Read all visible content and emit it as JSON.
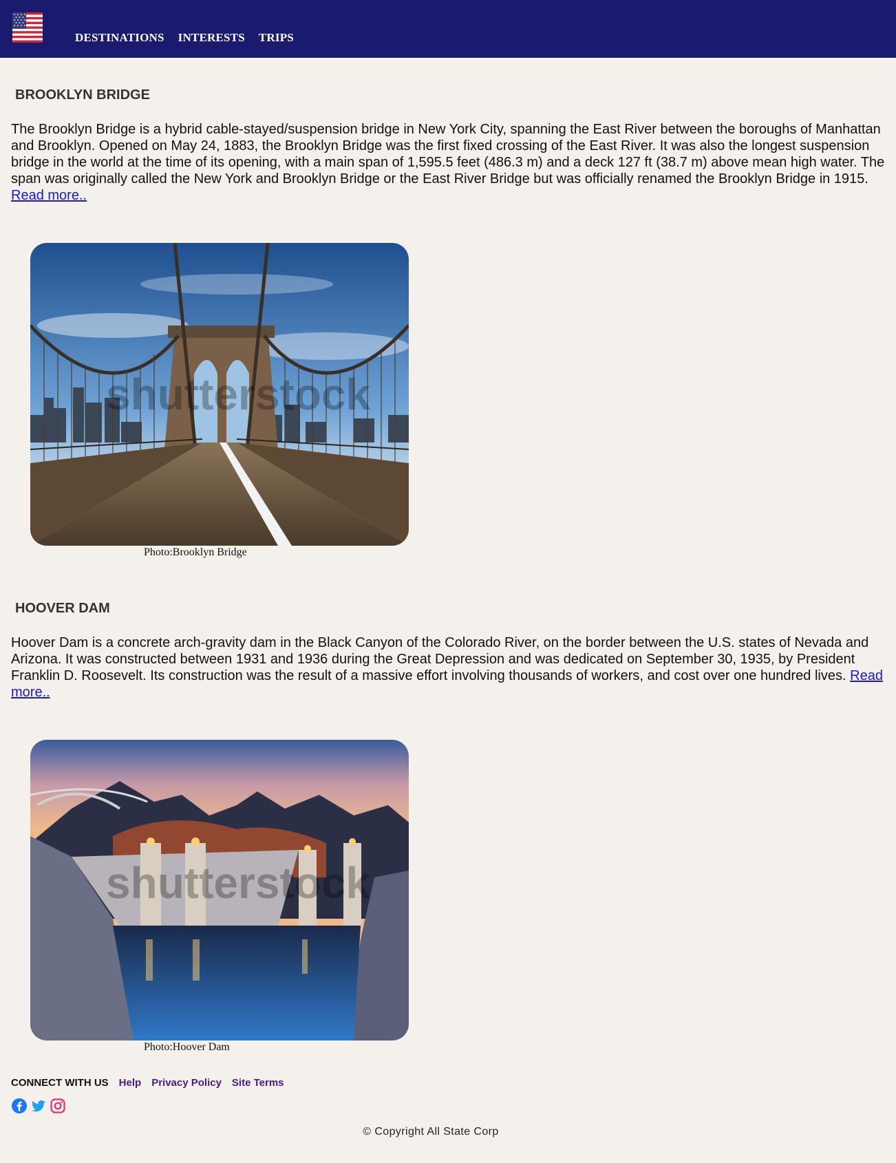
{
  "header": {
    "logo_icon": "us-flag-icon",
    "nav": [
      "DESTINATIONS",
      "INTERESTS",
      "TRIPS"
    ]
  },
  "sections": [
    {
      "title": "BROOKLYN BRIDGE",
      "text": "The Brooklyn Bridge is a hybrid cable-stayed/suspension bridge in New York City, spanning the East River between the boroughs of Manhattan and Brooklyn. Opened on May 24, 1883, the Brooklyn Bridge was the first fixed crossing of the East River. It was also the longest suspension bridge in the world at the time of its opening, with a main span of 1,595.5 feet (486.3 m) and a deck 127 ft (38.7 m) above mean high water. The span was originally called the New York and Brooklyn Bridge or the East River Bridge but was officially renamed the Brooklyn Bridge in 1915.",
      "read_more": "Read more..",
      "caption": "Photo:Brooklyn Bridge",
      "watermark": "shutterstock"
    },
    {
      "title": "HOOVER DAM",
      "text": "Hoover Dam is a concrete arch-gravity dam in the Black Canyon of the Colorado River, on the border between the U.S. states of Nevada and Arizona. It was constructed between 1931 and 1936 during the Great Depression and was dedicated on September 30, 1935, by President Franklin D. Roosevelt. Its construction was the result of a massive effort involving thousands of workers, and cost over one hundred lives.",
      "read_more": "Read more..",
      "caption": "Photo:Hoover Dam",
      "watermark": "shutterstock"
    }
  ],
  "footer": {
    "connect_label": "CONNECT WITH US",
    "links": [
      "Help",
      "Privacy Policy",
      "Site Terms"
    ],
    "social_icons": [
      "facebook-icon",
      "twitter-icon",
      "instagram-icon"
    ],
    "copyright": "© Copyright All State Corp"
  },
  "colors": {
    "header_bg": "#1a1a6e",
    "page_bg": "#f4f1ed",
    "link": "#1a1ad2",
    "footer_link": "#4a1a8a"
  }
}
